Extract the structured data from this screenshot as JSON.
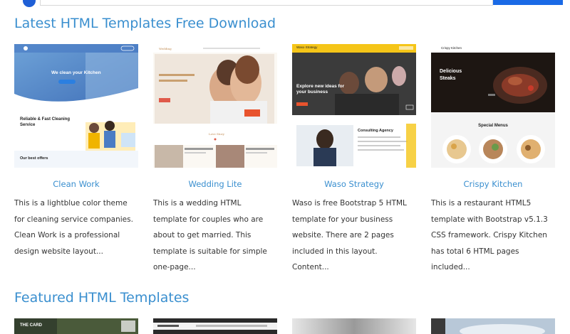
{
  "sections": {
    "latest_title": "Latest HTML Templates Free Download",
    "featured_title": "Featured HTML Templates"
  },
  "templates": [
    {
      "name": "Clean Work",
      "description": "This is a lightblue color theme for cleaning service companies. Clean Work is a professional design website layout...",
      "thumb_text": {
        "hero": "We clean your Kitchen",
        "heading": "Reliable & Fast Cleaning Service",
        "footer": "Our best offers"
      }
    },
    {
      "name": "Wedding Lite",
      "description": "This is a wedding HTML template for couples who are about to get married. This template is suitable for simple one-page..."
    },
    {
      "name": "Waso Strategy",
      "description": "Waso is free Bootstrap 5 HTML template for your business website. There are 2 pages included in this layout. Content...",
      "thumb_text": {
        "brand": "Waso Strategy",
        "hero": "Explore new ideas for your business",
        "panel": "Consulting Agency"
      }
    },
    {
      "name": "Crispy Kitchen",
      "description": "This is a restaurant HTML5 template with Bootstrap v5.1.3 CSS framework. Crispy Kitchen has total 6 HTML pages included...",
      "thumb_text": {
        "brand": "Crispy Kitchen",
        "hero": "Delicious Steaks",
        "menus": "Special Menus"
      }
    }
  ],
  "featured": [
    {
      "thumb_text": "THE CARD"
    },
    {
      "thumb_text": ""
    },
    {
      "thumb_text": ""
    },
    {
      "thumb_text": ""
    }
  ],
  "colors": {
    "accent": "#3a8fcf",
    "search_button": "#1a6ae6"
  }
}
